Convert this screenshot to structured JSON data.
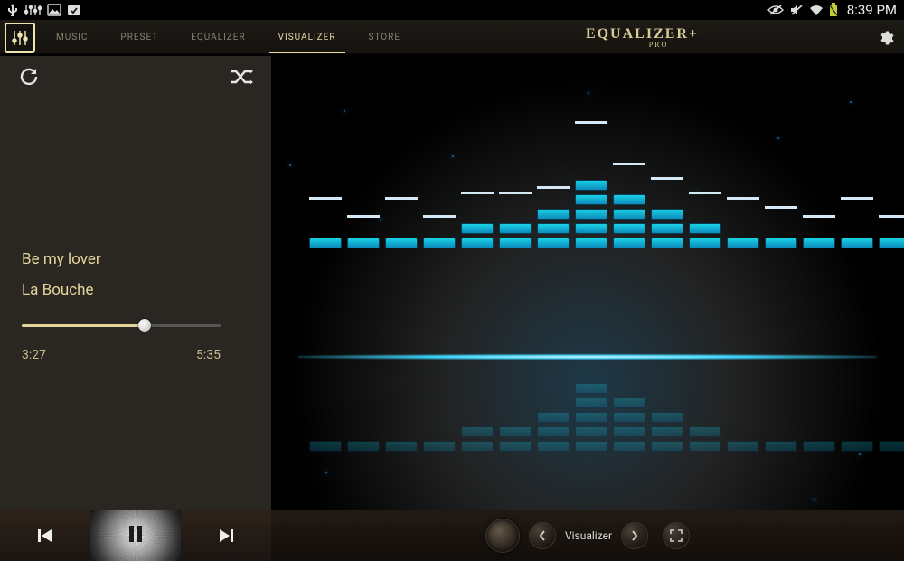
{
  "status": {
    "time": "8:39 PM"
  },
  "app": {
    "logo_main": "EQUALIZER+",
    "logo_sub": "PRO"
  },
  "tabs": {
    "items": [
      "MUSIC",
      "PRESET",
      "EQUALIZER",
      "VISUALIZER",
      "STORE"
    ],
    "active_index": 3
  },
  "nowplaying": {
    "title": "Be my lover",
    "artist": "La Bouche",
    "elapsed": "3:27",
    "duration": "5:35",
    "progress_pct": 62
  },
  "visualizer": {
    "selector_label": "Visualizer",
    "bars": [
      1,
      1,
      1,
      1,
      2,
      2,
      3,
      5,
      4,
      3,
      2,
      1,
      1,
      1,
      1,
      1
    ],
    "floats_above": [
      3,
      1,
      3,
      1,
      2,
      2,
      1,
      5,
      2,
      2,
      2,
      3,
      2,
      1,
      3,
      1
    ]
  },
  "colors": {
    "accent": "#e4d69a",
    "eq_cell": "#19d2e5",
    "glow": "#3ad6ff"
  }
}
